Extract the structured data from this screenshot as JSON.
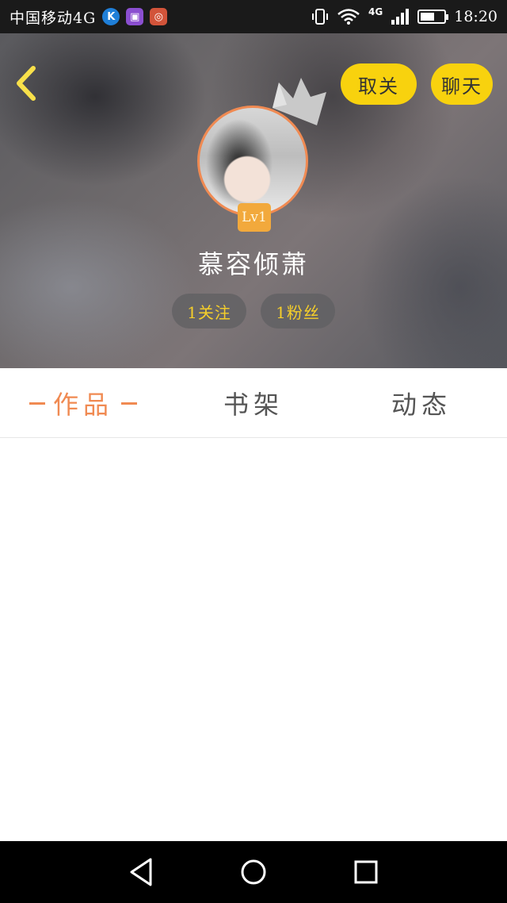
{
  "status_bar": {
    "carrier": "中国移动4G",
    "network": "4G",
    "time": "18:20",
    "battery_level": 0.6,
    "app_icons": [
      "k-app-icon",
      "gallery-app-icon",
      "red-app-icon"
    ]
  },
  "header": {
    "unfollow_label": "取关",
    "chat_label": "聊天",
    "level": "Lv1",
    "nickname": "慕容倾萧",
    "following_label": "1关注",
    "fans_label": "1粉丝",
    "accent_color": "#f8d20e"
  },
  "tabs": [
    {
      "label": "作品",
      "active": true
    },
    {
      "label": "书架",
      "active": false
    },
    {
      "label": "动态",
      "active": false
    }
  ],
  "colors": {
    "tab_active": "#f08a52",
    "avatar_ring": "#f08a52",
    "level_badge": "#f2a93c"
  }
}
